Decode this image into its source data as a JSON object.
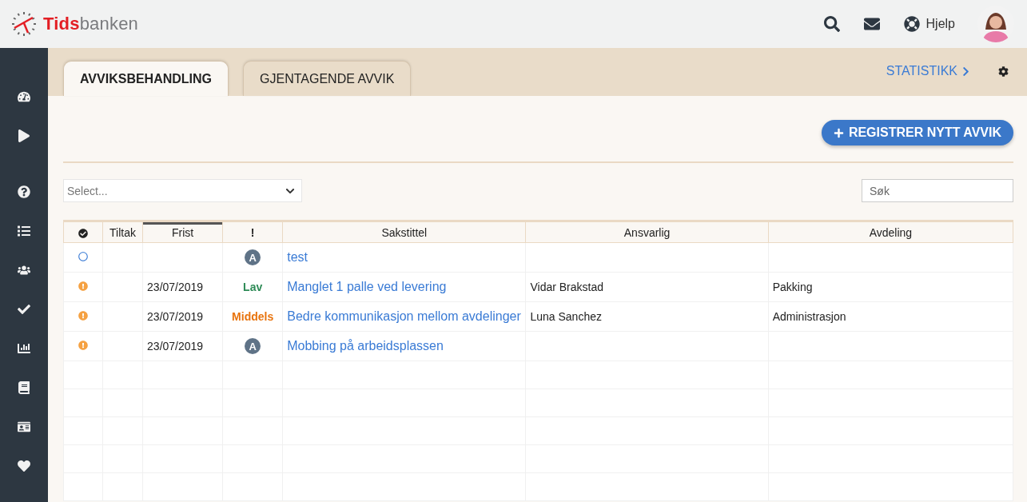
{
  "header": {
    "logo": {
      "lead": "Tids",
      "rest": "banken"
    },
    "help": "Hjelp"
  },
  "tabs": [
    {
      "label": "AVVIKSBEHANDLING",
      "selected": true
    },
    {
      "label": "GJENTAGENDE AVVIK",
      "selected": false
    }
  ],
  "statistics_link": "STATISTIKK",
  "register_button": "REGISTRER NYTT AVVIK",
  "filter": {
    "placeholder": "Select..."
  },
  "search": {
    "placeholder": "Søk"
  },
  "table": {
    "columns": [
      {
        "kind": "icon",
        "sorted": false
      },
      {
        "kind": "text",
        "label": "Tiltak",
        "sorted": false
      },
      {
        "kind": "text",
        "label": "Frist",
        "sorted": true
      },
      {
        "kind": "text",
        "label": "!",
        "sorted": false
      },
      {
        "kind": "text",
        "label": "Sakstittel",
        "sorted": false
      },
      {
        "kind": "text",
        "label": "Ansvarlig",
        "sorted": false
      },
      {
        "kind": "text",
        "label": "Avdeling",
        "sorted": false
      }
    ],
    "rows": [
      {
        "status": {
          "kind": "open"
        },
        "priority": {
          "kind": "badge",
          "text": "A"
        },
        "title": "test"
      },
      {
        "status": {
          "kind": "warning"
        },
        "frist": "23/07/2019",
        "priority": {
          "kind": "label",
          "text": "Lav",
          "color": "#2e8b57"
        },
        "title": "Manglet 1 palle ved levering",
        "ansvarlig": "Vidar Brakstad",
        "avdeling": "Pakking"
      },
      {
        "status": {
          "kind": "warning"
        },
        "frist": "23/07/2019",
        "priority": {
          "kind": "label",
          "text": "Middels",
          "color": "#e8730c"
        },
        "title": "Bedre kommunikasjon mellom avdelinger",
        "ansvarlig": "Luna Sanchez",
        "avdeling": "Administrasjon"
      },
      {
        "status": {
          "kind": "warning"
        },
        "frist": "23/07/2019",
        "priority": {
          "kind": "badge",
          "text": "A"
        },
        "title": "Mobbing på arbeidsplassen"
      }
    ]
  }
}
